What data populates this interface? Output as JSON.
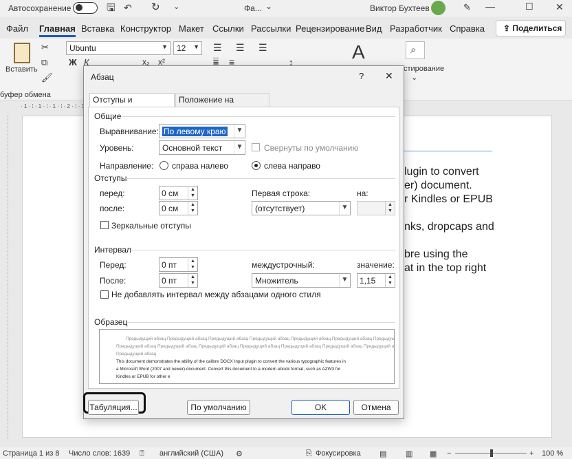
{
  "titlebar": {
    "autosave": "Автосохранение",
    "doc": "Фа...",
    "user": "Виктор Бухтеев",
    "dropdown": "⌄"
  },
  "tabs": [
    "Файл",
    "Главная",
    "Вставка",
    "Конструктор",
    "Макет",
    "Ссылки",
    "Рассылки",
    "Рецензирование",
    "Вид",
    "Разработчик",
    "Справка"
  ],
  "share_label": "Поделиться",
  "ribbon": {
    "paste": "Вставить",
    "clipboard": "буфер обмена",
    "font": "Ubuntu",
    "size": "12",
    "editing": "стирование",
    "bold": "Ж",
    "italic": "К",
    "sub": "x₂",
    "sup": "x²"
  },
  "ruler": "· 1 · ⁞ · 1 · ⁞ · 1 · ⁞ · 2 · ⁞ · 3 · ⁞ · 4 · ⁞ · 5 · ⁞ · 6 · ⁞ · 7 · ⁞ · 8 · ⁞ · 9 · ⁞ · 10 · ⁞ · 11 · ⁞ · 12 · ⁞ · 13 · ⁞ · 14 · ⁞ · 15 · ⁞ · 16 · ⁞ · 17 · ⁞ · 18 · ⁞",
  "doc_lines": [
    "lugin to convert",
    "er) document.",
    "r Kindles or EPUB",
    "nks, dropcaps and",
    "bre using the",
    "at in the top right"
  ],
  "status": {
    "page": "Страница 1 из 8",
    "words": "Число слов: 1639",
    "lang": "английский (США)",
    "focus": "Фокусировка",
    "zoom": "100 %"
  },
  "dialog": {
    "title": "Абзац",
    "help": "?",
    "close": "✕",
    "tab_indents": "Отступы и интервалы",
    "tab_position": "Положение на странице",
    "general": "Общие",
    "align_label": "Выравнивание:",
    "align_value": "По левому краю",
    "level_label": "Уровень:",
    "level_value": "Основной текст",
    "collapsed_label": "Свернуты по умолчанию",
    "direction_label": "Направление:",
    "rtl_label": "справа налево",
    "ltr_label": "слева направо",
    "indents": "Отступы",
    "before_label": "перед:",
    "before_value": "0 см",
    "after_label": "после:",
    "after_value": "0 см",
    "first_line_label": "Первая строка:",
    "first_line_value": "(отсутствует)",
    "on_label": "на:",
    "mirror_label": "Зеркальные отступы",
    "spacing": "Интервал",
    "sp_before_label": "Перед:",
    "sp_before_value": "0 пт",
    "sp_after_label": "После:",
    "sp_after_value": "0 пт",
    "line_label": "междустрочный:",
    "line_value": "Множитель",
    "value_label": "значение:",
    "value_value": "1,15",
    "no_space_label": "Не добавлять интервал между абзацами одного стиля",
    "sample": "Образец",
    "preview_prev": "Предыдущий абзац Предыдущий абзац Предыдущий абзац Предыдущий абзац Предыдущий абзац Предыдущий абзац Предыдущий абзац",
    "preview_prev2": "Предыдущий абзац",
    "preview_text1": "This document demonstrates the ability of the calibre DOCX Input plugin to convert the various typographic features in",
    "preview_text2": "a Microsoft Word (2007 and newer) document. Convert this document to a modern ebook format, such as AZW3 for",
    "preview_text3": "Kindles or EPUB for other e",
    "btn_tabs": "Табуляция...",
    "btn_default": "По умолчанию",
    "btn_ok": "OK",
    "btn_cancel": "Отмена"
  }
}
